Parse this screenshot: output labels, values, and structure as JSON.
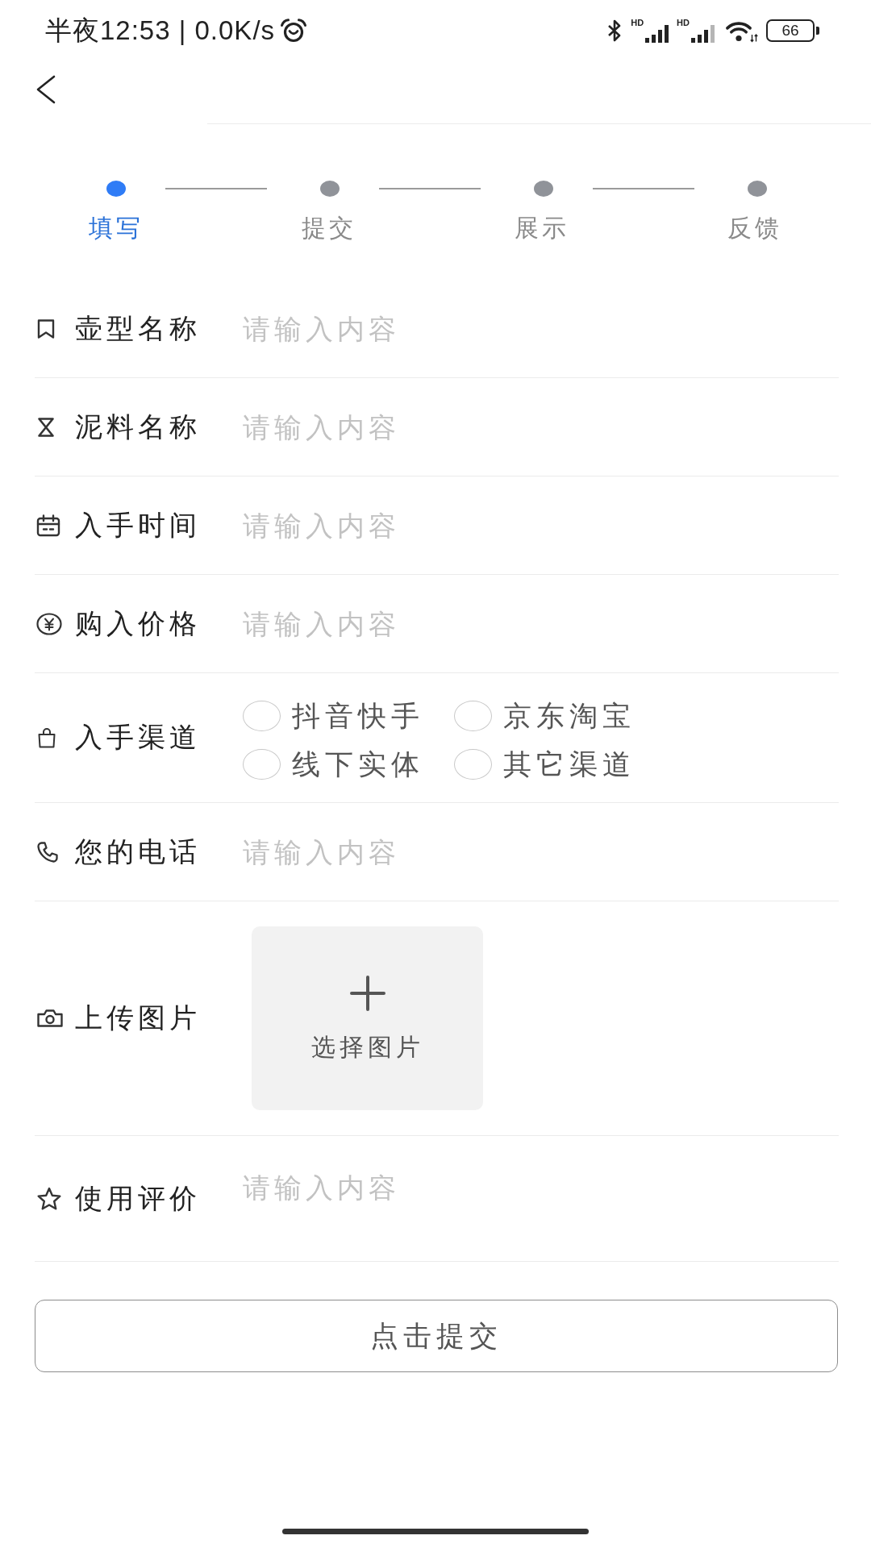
{
  "status_bar": {
    "time_and_speed": "半夜12:53 | 0.0K/s",
    "signals": [
      {
        "label": "HD"
      },
      {
        "label": "HD"
      }
    ],
    "battery": "66"
  },
  "steps": [
    {
      "label": "填写",
      "selected": true
    },
    {
      "label": "提交",
      "selected": false
    },
    {
      "label": "展示",
      "selected": false
    },
    {
      "label": "反馈",
      "selected": false
    }
  ],
  "form": [
    {
      "kind": "input",
      "label": "壶型名称",
      "placeholder": "请输入内容"
    },
    {
      "kind": "input",
      "label": "泥料名称",
      "placeholder": "请输入内容"
    },
    {
      "kind": "input",
      "label": "入手时间",
      "placeholder": "请输入内容"
    },
    {
      "kind": "input",
      "label": "购入价格",
      "placeholder": "请输入内容"
    },
    {
      "kind": "radio",
      "label": "入手渠道",
      "options": [
        {
          "label": "抖音快手",
          "selected": false
        },
        {
          "label": "京东淘宝",
          "selected": false
        },
        {
          "label": "线下实体",
          "selected": false
        },
        {
          "label": "其它渠道",
          "selected": false
        }
      ]
    },
    {
      "kind": "input",
      "label": "您的电话",
      "placeholder": "请输入内容"
    },
    {
      "kind": "upload",
      "label": "上传图片",
      "button": "选择图片"
    },
    {
      "kind": "textarea",
      "label": "使用评价",
      "placeholder": "请输入内容"
    }
  ],
  "submit_button": "点击提交"
}
